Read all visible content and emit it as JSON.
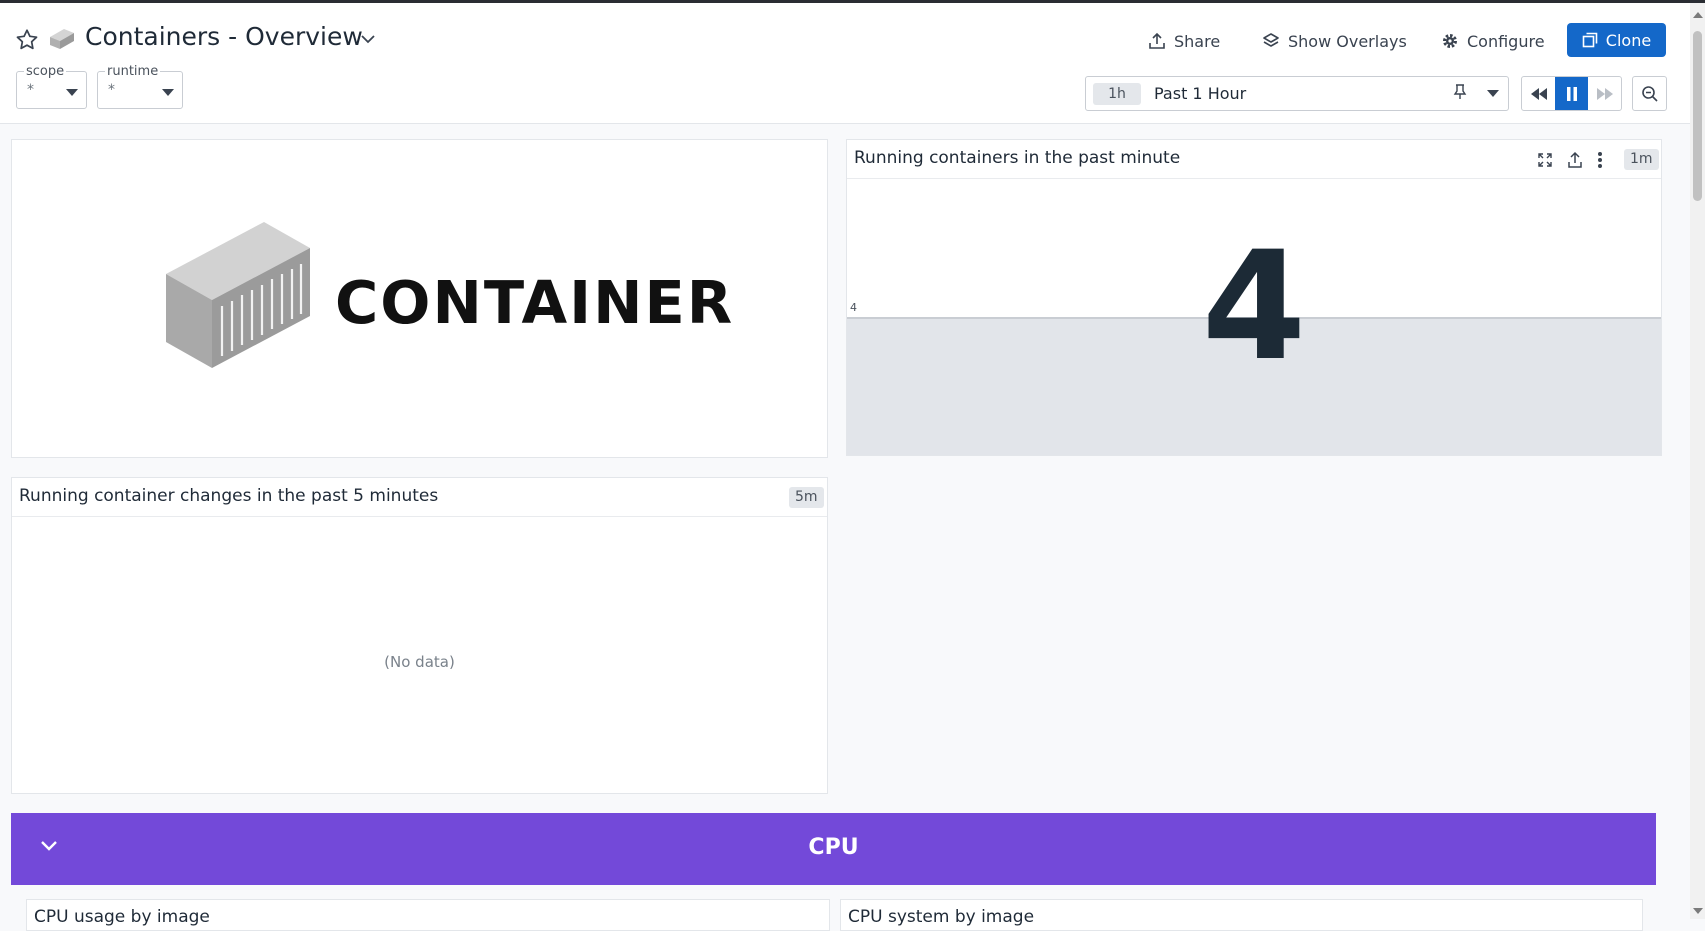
{
  "header": {
    "title": "Containers - Overview",
    "buttons": {
      "share": "Share",
      "overlays": "Show Overlays",
      "configure": "Configure",
      "clone": "Clone"
    },
    "variables": [
      {
        "label": "scope",
        "value": "*"
      },
      {
        "label": "runtime",
        "value": "*"
      }
    ],
    "time": {
      "badge": "1h",
      "label": "Past 1 Hour"
    }
  },
  "widgets": {
    "logo": {
      "text": "CONTAINER"
    },
    "running": {
      "title": "Running containers in the past minute",
      "badge": "1m",
      "value": "4",
      "axis_tick": "4"
    },
    "changes": {
      "title": "Running container changes in the past 5 minutes",
      "badge": "5m",
      "empty": "(No data)"
    }
  },
  "groups": {
    "cpu": {
      "title": "CPU",
      "sub_left": "CPU usage by image",
      "sub_right": "CPU system by image"
    }
  },
  "colors": {
    "accent": "#1468c9",
    "cpu_group": "#7349d9"
  }
}
